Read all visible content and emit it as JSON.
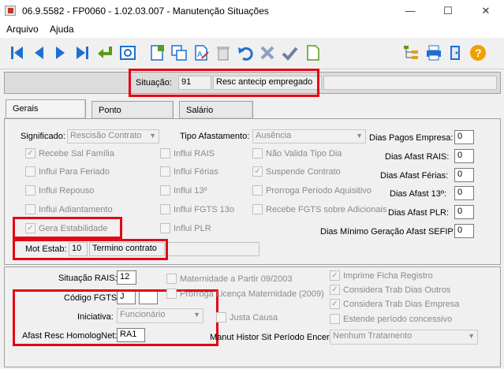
{
  "window": {
    "title": "06.9.5582 - FP0060 - 1.02.03.007 - Manutenção Situações",
    "minimize": "—",
    "maximize": "☐",
    "close": "✕"
  },
  "menu": [
    "Arquivo",
    "Ajuda"
  ],
  "toolbar_icons": [
    "first-icon",
    "prev-icon",
    "next-icon",
    "last-icon",
    "return-icon",
    "preview-icon",
    "new-icon",
    "copy-icon",
    "edit-icon",
    "delete-icon",
    "undo-icon",
    "cancel-icon",
    "confirm-icon",
    "blank-icon",
    "tree-icon",
    "print-icon",
    "exit-icon",
    "help-icon"
  ],
  "situacao": {
    "label": "Situação:",
    "code": "91",
    "description": "Resc antecip empregado"
  },
  "tabs": [
    "Gerais",
    "Ponto",
    "Salário"
  ],
  "gerais": {
    "significado_label": "Significado:",
    "significado_value": "Rescisão Contrato",
    "tipo_afastamento_label": "Tipo Afastamento:",
    "tipo_afastamento_value": "Ausência",
    "checks_col1": [
      {
        "label": "Recebe Sal Família",
        "checked": true
      },
      {
        "label": "Influi Para Feriado",
        "checked": false
      },
      {
        "label": "Influi Repouso",
        "checked": false
      },
      {
        "label": "Influi Adiantamento",
        "checked": false
      },
      {
        "label": "Gera Estabilidade",
        "checked": true
      }
    ],
    "checks_col2": [
      {
        "label": "Influi RAIS",
        "checked": false
      },
      {
        "label": "Influi Férias",
        "checked": false
      },
      {
        "label": "Influi 13º",
        "checked": false
      },
      {
        "label": "Influi FGTS 13o",
        "checked": false
      },
      {
        "label": "Influi PLR",
        "checked": false
      }
    ],
    "checks_col3": [
      {
        "label": "Não Valida Tipo Dia",
        "checked": false
      },
      {
        "label": "Suspende Contrato",
        "checked": true
      },
      {
        "label": "Prorroga Período Aquisitivo",
        "checked": false
      },
      {
        "label": "Recebe FGTS sobre Adicionais",
        "checked": false
      }
    ],
    "dias": [
      {
        "label": "Dias Pagos Empresa:",
        "value": "0"
      },
      {
        "label": "Dias Afast RAIS:",
        "value": "0"
      },
      {
        "label": "Dias Afast Férias:",
        "value": "0"
      },
      {
        "label": "Dias Afast 13º:",
        "value": "0"
      },
      {
        "label": "Dias Afast PLR:",
        "value": "0"
      },
      {
        "label": "Dias Mínimo Geração Afast SEFIP:",
        "value": "0"
      }
    ],
    "mot_estab_label": "Mot Estab:",
    "mot_estab_code": "10",
    "mot_estab_desc": "Termino contrato"
  },
  "lower": {
    "situacao_rais_label": "Situação RAIS:",
    "situacao_rais_value": "12",
    "codigo_fgts_label": "Código FGTS:",
    "codigo_fgts_value": "J",
    "iniciativa_label": "Iniciativa:",
    "iniciativa_value": "Funcionário",
    "afast_resc_label": "Afast Resc HomologNet:",
    "afast_resc_value": "RA1",
    "checks_mid": [
      {
        "label": "Maternidade a Partir 09/2003",
        "checked": false
      },
      {
        "label": "Prorroga Licença Maternidade (2009)",
        "checked": false
      },
      {
        "label": "Justa Causa",
        "checked": false
      }
    ],
    "checks_right": [
      {
        "label": "Imprime Ficha Registro",
        "checked": true
      },
      {
        "label": "Considera Trab Dias Outros",
        "checked": true
      },
      {
        "label": "Considera Trab Dias Empresa",
        "checked": true
      },
      {
        "label": "Estende período concessivo",
        "checked": false
      }
    ],
    "manut_label": "Manut Histor Sit Período Encer:",
    "manut_value": "Nenhum Tratamento"
  }
}
